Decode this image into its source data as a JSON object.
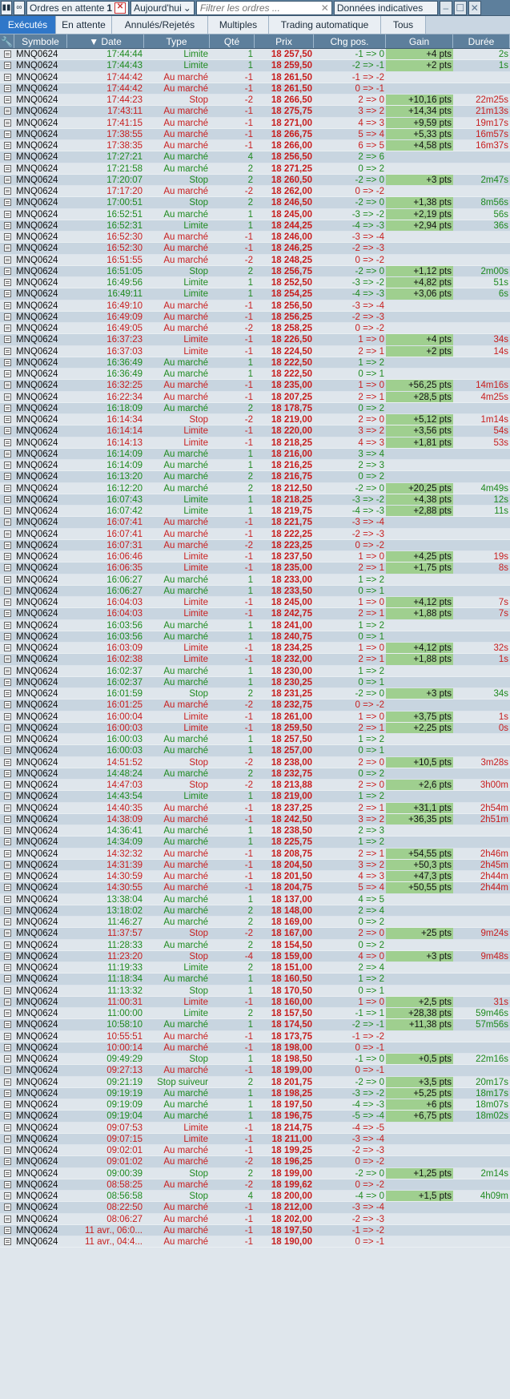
{
  "toolbar": {
    "pending_label": "Ordres en attente",
    "pending_count": "1",
    "period_select": "Aujourd'hui",
    "filter_placeholder": "Filtrer les ordres ...",
    "data_label": "Données indicatives"
  },
  "tabs": [
    {
      "label": "Exécutés",
      "active": true
    },
    {
      "label": "En attente",
      "active": false
    },
    {
      "label": "Annulés/Rejetés",
      "active": false
    },
    {
      "label": "Multiples",
      "active": false
    },
    {
      "label": "Trading automatique",
      "active": false
    },
    {
      "label": "Tous",
      "active": false
    }
  ],
  "columns": [
    "Symbole",
    "Date",
    "Type",
    "Qté",
    "Prix",
    "Chg pos.",
    "Gain",
    "Durée"
  ],
  "colors": {
    "buy": "#1f8a1f",
    "sell": "#c81e1e",
    "gain_bg": "#9fcf8f",
    "active_tab": "#2f77c9"
  },
  "rows": [
    [
      "MNQ0624",
      "17:44:44",
      "Limite",
      "1",
      "18 257,50",
      "-1 => 0",
      "+4 pts",
      "2s"
    ],
    [
      "MNQ0624",
      "17:44:43",
      "Limite",
      "1",
      "18 259,50",
      "-2 => -1",
      "+2 pts",
      "1s"
    ],
    [
      "MNQ0624",
      "17:44:42",
      "Au marché",
      "-1",
      "18 261,50",
      "-1 => -2",
      "",
      ""
    ],
    [
      "MNQ0624",
      "17:44:42",
      "Au marché",
      "-1",
      "18 261,50",
      "0 => -1",
      "",
      ""
    ],
    [
      "MNQ0624",
      "17:44:23",
      "Stop",
      "-2",
      "18 266,50",
      "2 => 0",
      "+10,16 pts",
      "22m25s"
    ],
    [
      "MNQ0624",
      "17:43:11",
      "Au marché",
      "-1",
      "18 275,75",
      "3 => 2",
      "+14,34 pts",
      "21m13s"
    ],
    [
      "MNQ0624",
      "17:41:15",
      "Au marché",
      "-1",
      "18 271,00",
      "4 => 3",
      "+9,59 pts",
      "19m17s"
    ],
    [
      "MNQ0624",
      "17:38:55",
      "Au marché",
      "-1",
      "18 266,75",
      "5 => 4",
      "+5,33 pts",
      "16m57s"
    ],
    [
      "MNQ0624",
      "17:38:35",
      "Au marché",
      "-1",
      "18 266,00",
      "6 => 5",
      "+4,58 pts",
      "16m37s"
    ],
    [
      "MNQ0624",
      "17:27:21",
      "Au marché",
      "4",
      "18 256,50",
      "2 => 6",
      "",
      ""
    ],
    [
      "MNQ0624",
      "17:21:58",
      "Au marché",
      "2",
      "18 271,25",
      "0 => 2",
      "",
      ""
    ],
    [
      "MNQ0624",
      "17:20:07",
      "Stop",
      "2",
      "18 260,50",
      "-2 => 0",
      "+3 pts",
      "2m47s"
    ],
    [
      "MNQ0624",
      "17:17:20",
      "Au marché",
      "-2",
      "18 262,00",
      "0 => -2",
      "",
      ""
    ],
    [
      "MNQ0624",
      "17:00:51",
      "Stop",
      "2",
      "18 246,50",
      "-2 => 0",
      "+1,38 pts",
      "8m56s"
    ],
    [
      "MNQ0624",
      "16:52:51",
      "Au marché",
      "1",
      "18 245,00",
      "-3 => -2",
      "+2,19 pts",
      "56s"
    ],
    [
      "MNQ0624",
      "16:52:31",
      "Limite",
      "1",
      "18 244,25",
      "-4 => -3",
      "+2,94 pts",
      "36s"
    ],
    [
      "MNQ0624",
      "16:52:30",
      "Au marché",
      "-1",
      "18 246,00",
      "-3 => -4",
      "",
      ""
    ],
    [
      "MNQ0624",
      "16:52:30",
      "Au marché",
      "-1",
      "18 246,25",
      "-2 => -3",
      "",
      ""
    ],
    [
      "MNQ0624",
      "16:51:55",
      "Au marché",
      "-2",
      "18 248,25",
      "0 => -2",
      "",
      ""
    ],
    [
      "MNQ0624",
      "16:51:05",
      "Stop",
      "2",
      "18 256,75",
      "-2 => 0",
      "+1,12 pts",
      "2m00s"
    ],
    [
      "MNQ0624",
      "16:49:56",
      "Limite",
      "1",
      "18 252,50",
      "-3 => -2",
      "+4,82 pts",
      "51s"
    ],
    [
      "MNQ0624",
      "16:49:11",
      "Limite",
      "1",
      "18 254,25",
      "-4 => -3",
      "+3,06 pts",
      "6s"
    ],
    [
      "MNQ0624",
      "16:49:10",
      "Au marché",
      "-1",
      "18 256,50",
      "-3 => -4",
      "",
      ""
    ],
    [
      "MNQ0624",
      "16:49:09",
      "Au marché",
      "-1",
      "18 256,25",
      "-2 => -3",
      "",
      ""
    ],
    [
      "MNQ0624",
      "16:49:05",
      "Au marché",
      "-2",
      "18 258,25",
      "0 => -2",
      "",
      ""
    ],
    [
      "MNQ0624",
      "16:37:23",
      "Limite",
      "-1",
      "18 226,50",
      "1 => 0",
      "+4 pts",
      "34s"
    ],
    [
      "MNQ0624",
      "16:37:03",
      "Limite",
      "-1",
      "18 224,50",
      "2 => 1",
      "+2 pts",
      "14s"
    ],
    [
      "MNQ0624",
      "16:36:49",
      "Au marché",
      "1",
      "18 222,50",
      "1 => 2",
      "",
      ""
    ],
    [
      "MNQ0624",
      "16:36:49",
      "Au marché",
      "1",
      "18 222,50",
      "0 => 1",
      "",
      ""
    ],
    [
      "MNQ0624",
      "16:32:25",
      "Au marché",
      "-1",
      "18 235,00",
      "1 => 0",
      "+56,25 pts",
      "14m16s"
    ],
    [
      "MNQ0624",
      "16:22:34",
      "Au marché",
      "-1",
      "18 207,25",
      "2 => 1",
      "+28,5 pts",
      "4m25s"
    ],
    [
      "MNQ0624",
      "16:18:09",
      "Au marché",
      "2",
      "18 178,75",
      "0 => 2",
      "",
      ""
    ],
    [
      "MNQ0624",
      "16:14:34",
      "Stop",
      "-2",
      "18 219,00",
      "2 => 0",
      "+5,12 pts",
      "1m14s"
    ],
    [
      "MNQ0624",
      "16:14:14",
      "Limite",
      "-1",
      "18 220,00",
      "3 => 2",
      "+3,56 pts",
      "54s"
    ],
    [
      "MNQ0624",
      "16:14:13",
      "Limite",
      "-1",
      "18 218,25",
      "4 => 3",
      "+1,81 pts",
      "53s"
    ],
    [
      "MNQ0624",
      "16:14:09",
      "Au marché",
      "1",
      "18 216,00",
      "3 => 4",
      "",
      ""
    ],
    [
      "MNQ0624",
      "16:14:09",
      "Au marché",
      "1",
      "18 216,25",
      "2 => 3",
      "",
      ""
    ],
    [
      "MNQ0624",
      "16:13:20",
      "Au marché",
      "2",
      "18 216,75",
      "0 => 2",
      "",
      ""
    ],
    [
      "MNQ0624",
      "16:12:20",
      "Au marché",
      "2",
      "18 212,50",
      "-2 => 0",
      "+20,25 pts",
      "4m49s"
    ],
    [
      "MNQ0624",
      "16:07:43",
      "Limite",
      "1",
      "18 218,25",
      "-3 => -2",
      "+4,38 pts",
      "12s"
    ],
    [
      "MNQ0624",
      "16:07:42",
      "Limite",
      "1",
      "18 219,75",
      "-4 => -3",
      "+2,88 pts",
      "11s"
    ],
    [
      "MNQ0624",
      "16:07:41",
      "Au marché",
      "-1",
      "18 221,75",
      "-3 => -4",
      "",
      ""
    ],
    [
      "MNQ0624",
      "16:07:41",
      "Au marché",
      "-1",
      "18 222,25",
      "-2 => -3",
      "",
      ""
    ],
    [
      "MNQ0624",
      "16:07:31",
      "Au marché",
      "-2",
      "18 223,25",
      "0 => -2",
      "",
      ""
    ],
    [
      "MNQ0624",
      "16:06:46",
      "Limite",
      "-1",
      "18 237,50",
      "1 => 0",
      "+4,25 pts",
      "19s"
    ],
    [
      "MNQ0624",
      "16:06:35",
      "Limite",
      "-1",
      "18 235,00",
      "2 => 1",
      "+1,75 pts",
      "8s"
    ],
    [
      "MNQ0624",
      "16:06:27",
      "Au marché",
      "1",
      "18 233,00",
      "1 => 2",
      "",
      ""
    ],
    [
      "MNQ0624",
      "16:06:27",
      "Au marché",
      "1",
      "18 233,50",
      "0 => 1",
      "",
      ""
    ],
    [
      "MNQ0624",
      "16:04:03",
      "Limite",
      "-1",
      "18 245,00",
      "1 => 0",
      "+4,12 pts",
      "7s"
    ],
    [
      "MNQ0624",
      "16:04:03",
      "Limite",
      "-1",
      "18 242,75",
      "2 => 1",
      "+1,88 pts",
      "7s"
    ],
    [
      "MNQ0624",
      "16:03:56",
      "Au marché",
      "1",
      "18 241,00",
      "1 => 2",
      "",
      ""
    ],
    [
      "MNQ0624",
      "16:03:56",
      "Au marché",
      "1",
      "18 240,75",
      "0 => 1",
      "",
      ""
    ],
    [
      "MNQ0624",
      "16:03:09",
      "Limite",
      "-1",
      "18 234,25",
      "1 => 0",
      "+4,12 pts",
      "32s"
    ],
    [
      "MNQ0624",
      "16:02:38",
      "Limite",
      "-1",
      "18 232,00",
      "2 => 1",
      "+1,88 pts",
      "1s"
    ],
    [
      "MNQ0624",
      "16:02:37",
      "Au marché",
      "1",
      "18 230,00",
      "1 => 2",
      "",
      ""
    ],
    [
      "MNQ0624",
      "16:02:37",
      "Au marché",
      "1",
      "18 230,25",
      "0 => 1",
      "",
      ""
    ],
    [
      "MNQ0624",
      "16:01:59",
      "Stop",
      "2",
      "18 231,25",
      "-2 => 0",
      "+3 pts",
      "34s"
    ],
    [
      "MNQ0624",
      "16:01:25",
      "Au marché",
      "-2",
      "18 232,75",
      "0 => -2",
      "",
      ""
    ],
    [
      "MNQ0624",
      "16:00:04",
      "Limite",
      "-1",
      "18 261,00",
      "1 => 0",
      "+3,75 pts",
      "1s"
    ],
    [
      "MNQ0624",
      "16:00:03",
      "Limite",
      "-1",
      "18 259,50",
      "2 => 1",
      "+2,25 pts",
      "0s"
    ],
    [
      "MNQ0624",
      "16:00:03",
      "Au marché",
      "1",
      "18 257,50",
      "1 => 2",
      "",
      ""
    ],
    [
      "MNQ0624",
      "16:00:03",
      "Au marché",
      "1",
      "18 257,00",
      "0 => 1",
      "",
      ""
    ],
    [
      "MNQ0624",
      "14:51:52",
      "Stop",
      "-2",
      "18 238,00",
      "2 => 0",
      "+10,5 pts",
      "3m28s"
    ],
    [
      "MNQ0624",
      "14:48:24",
      "Au marché",
      "2",
      "18 232,75",
      "0 => 2",
      "",
      ""
    ],
    [
      "MNQ0624",
      "14:47:03",
      "Stop",
      "-2",
      "18 213,88",
      "2 => 0",
      "+2,6 pts",
      "3h00m"
    ],
    [
      "MNQ0624",
      "14:43:54",
      "Limite",
      "1",
      "18 219,00",
      "1 => 2",
      "",
      ""
    ],
    [
      "MNQ0624",
      "14:40:35",
      "Au marché",
      "-1",
      "18 237,25",
      "2 => 1",
      "+31,1 pts",
      "2h54m"
    ],
    [
      "MNQ0624",
      "14:38:09",
      "Au marché",
      "-1",
      "18 242,50",
      "3 => 2",
      "+36,35 pts",
      "2h51m"
    ],
    [
      "MNQ0624",
      "14:36:41",
      "Au marché",
      "1",
      "18 238,50",
      "2 => 3",
      "",
      ""
    ],
    [
      "MNQ0624",
      "14:34:09",
      "Au marché",
      "1",
      "18 225,75",
      "1 => 2",
      "",
      ""
    ],
    [
      "MNQ0624",
      "14:32:32",
      "Au marché",
      "-1",
      "18 208,75",
      "2 => 1",
      "+54,55 pts",
      "2h46m"
    ],
    [
      "MNQ0624",
      "14:31:39",
      "Au marché",
      "-1",
      "18 204,50",
      "3 => 2",
      "+50,3 pts",
      "2h45m"
    ],
    [
      "MNQ0624",
      "14:30:59",
      "Au marché",
      "-1",
      "18 201,50",
      "4 => 3",
      "+47,3 pts",
      "2h44m"
    ],
    [
      "MNQ0624",
      "14:30:55",
      "Au marché",
      "-1",
      "18 204,75",
      "5 => 4",
      "+50,55 pts",
      "2h44m"
    ],
    [
      "MNQ0624",
      "13:38:04",
      "Au marché",
      "1",
      "18 137,00",
      "4 => 5",
      "",
      ""
    ],
    [
      "MNQ0624",
      "13:18:02",
      "Au marché",
      "2",
      "18 148,00",
      "2 => 4",
      "",
      ""
    ],
    [
      "MNQ0624",
      "11:46:27",
      "Au marché",
      "2",
      "18 169,00",
      "0 => 2",
      "",
      ""
    ],
    [
      "MNQ0624",
      "11:37:57",
      "Stop",
      "-2",
      "18 167,00",
      "2 => 0",
      "+25 pts",
      "9m24s"
    ],
    [
      "MNQ0624",
      "11:28:33",
      "Au marché",
      "2",
      "18 154,50",
      "0 => 2",
      "",
      ""
    ],
    [
      "MNQ0624",
      "11:23:20",
      "Stop",
      "-4",
      "18 159,00",
      "4 => 0",
      "+3 pts",
      "9m48s"
    ],
    [
      "MNQ0624",
      "11:19:33",
      "Limite",
      "2",
      "18 151,00",
      "2 => 4",
      "",
      ""
    ],
    [
      "MNQ0624",
      "11:18:34",
      "Au marché",
      "1",
      "18 160,50",
      "1 => 2",
      "",
      ""
    ],
    [
      "MNQ0624",
      "11:13:32",
      "Stop",
      "1",
      "18 170,50",
      "0 => 1",
      "",
      ""
    ],
    [
      "MNQ0624",
      "11:00:31",
      "Limite",
      "-1",
      "18 160,00",
      "1 => 0",
      "+2,5 pts",
      "31s"
    ],
    [
      "MNQ0624",
      "11:00:00",
      "Limite",
      "2",
      "18 157,50",
      "-1 => 1",
      "+28,38 pts",
      "59m46s"
    ],
    [
      "MNQ0624",
      "10:58:10",
      "Au marché",
      "1",
      "18 174,50",
      "-2 => -1",
      "+11,38 pts",
      "57m56s"
    ],
    [
      "MNQ0624",
      "10:55:51",
      "Au marché",
      "-1",
      "18 173,75",
      "-1 => -2",
      "",
      ""
    ],
    [
      "MNQ0624",
      "10:00:14",
      "Au marché",
      "-1",
      "18 198,00",
      "0 => -1",
      "",
      ""
    ],
    [
      "MNQ0624",
      "09:49:29",
      "Stop",
      "1",
      "18 198,50",
      "-1 => 0",
      "+0,5 pts",
      "22m16s"
    ],
    [
      "MNQ0624",
      "09:27:13",
      "Au marché",
      "-1",
      "18 199,00",
      "0 => -1",
      "",
      ""
    ],
    [
      "MNQ0624",
      "09:21:19",
      "Stop suiveur",
      "2",
      "18 201,75",
      "-2 => 0",
      "+3,5 pts",
      "20m17s"
    ],
    [
      "MNQ0624",
      "09:19:19",
      "Au marché",
      "1",
      "18 198,25",
      "-3 => -2",
      "+5,25 pts",
      "18m17s"
    ],
    [
      "MNQ0624",
      "09:19:09",
      "Au marché",
      "1",
      "18 197,50",
      "-4 => -3",
      "+6 pts",
      "18m07s"
    ],
    [
      "MNQ0624",
      "09:19:04",
      "Au marché",
      "1",
      "18 196,75",
      "-5 => -4",
      "+6,75 pts",
      "18m02s"
    ],
    [
      "MNQ0624",
      "09:07:53",
      "Limite",
      "-1",
      "18 214,75",
      "-4 => -5",
      "",
      ""
    ],
    [
      "MNQ0624",
      "09:07:15",
      "Limite",
      "-1",
      "18 211,00",
      "-3 => -4",
      "",
      ""
    ],
    [
      "MNQ0624",
      "09:02:01",
      "Au marché",
      "-1",
      "18 199,25",
      "-2 => -3",
      "",
      ""
    ],
    [
      "MNQ0624",
      "09:01:02",
      "Au marché",
      "-2",
      "18 196,25",
      "0 => -2",
      "",
      ""
    ],
    [
      "MNQ0624",
      "09:00:39",
      "Stop",
      "2",
      "18 199,00",
      "-2 => 0",
      "+1,25 pts",
      "2m14s"
    ],
    [
      "MNQ0624",
      "08:58:25",
      "Au marché",
      "-2",
      "18 199,62",
      "0 => -2",
      "",
      ""
    ],
    [
      "MNQ0624",
      "08:56:58",
      "Stop",
      "4",
      "18 200,00",
      "-4 => 0",
      "+1,5 pts",
      "4h09m"
    ],
    [
      "MNQ0624",
      "08:22:50",
      "Au marché",
      "-1",
      "18 212,00",
      "-3 => -4",
      "",
      ""
    ],
    [
      "MNQ0624",
      "08:06:27",
      "Au marché",
      "-1",
      "18 202,00",
      "-2 => -3",
      "",
      ""
    ],
    [
      "MNQ0624",
      "11 avr., 06:0...",
      "Au marché",
      "-1",
      "18 197,50",
      "-1 => -2",
      "",
      ""
    ],
    [
      "MNQ0624",
      "11 avr., 04:4...",
      "Au marché",
      "-1",
      "18 190,00",
      "0 => -1",
      "",
      ""
    ]
  ]
}
